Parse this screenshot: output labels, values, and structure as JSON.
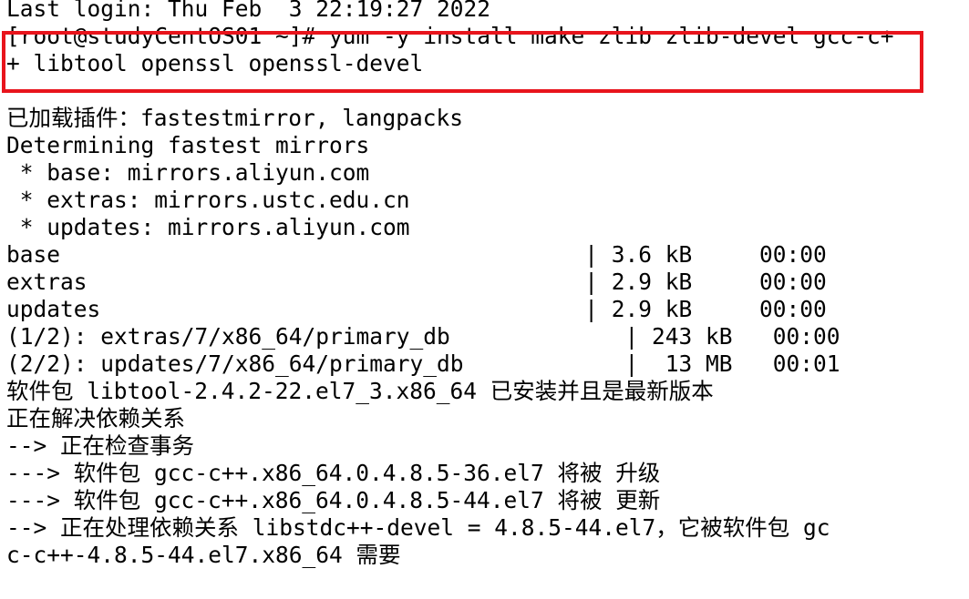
{
  "terminal": {
    "highlight_color": "#e8141c",
    "background": "#ffffff",
    "text_color": "#000000",
    "lines": [
      "Last login: Thu Feb  3 22:19:27 2022",
      "[root@studyCentOS01 ~]# yum -y install make zlib zlib-devel gcc-c+",
      "+ libtool openssl openssl-devel",
      "",
      "已加载插件：fastestmirror, langpacks",
      "Determining fastest mirrors",
      " * base: mirrors.aliyun.com",
      " * extras: mirrors.ustc.edu.cn",
      " * updates: mirrors.aliyun.com",
      "base                                       | 3.6 kB     00:00",
      "extras                                     | 2.9 kB     00:00",
      "updates                                    | 2.9 kB     00:00",
      "(1/2): extras/7/x86_64/primary_db             | 243 kB   00:00",
      "(2/2): updates/7/x86_64/primary_db            |  13 MB   00:01",
      "软件包 libtool-2.4.2-22.el7_3.x86_64 已安装并且是最新版本",
      "正在解决依赖关系",
      "--> 正在检查事务",
      "---> 软件包 gcc-c++.x86_64.0.4.8.5-36.el7 将被 升级",
      "---> 软件包 gcc-c++.x86_64.0.4.8.5-44.el7 将被 更新",
      "--> 正在处理依赖关系 libstdc++-devel = 4.8.5-44.el7，它被软件包 gc",
      "c-c++-4.8.5-44.el7.x86_64 需要"
    ]
  }
}
